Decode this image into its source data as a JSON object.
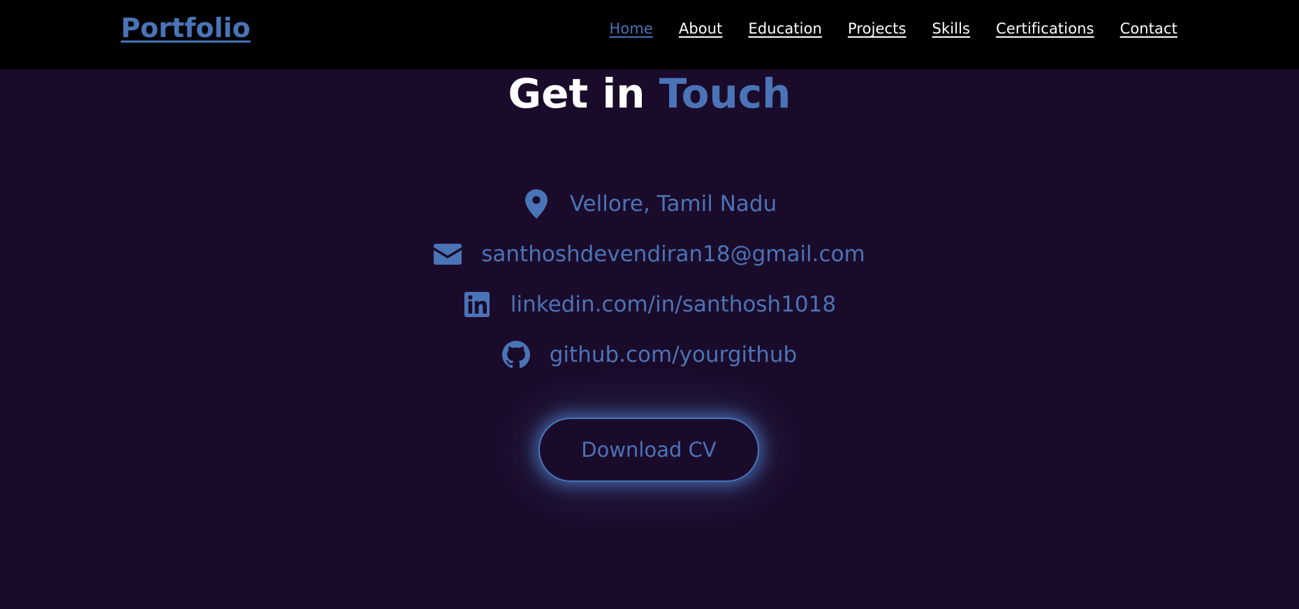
{
  "header": {
    "brand": "Portfolio",
    "nav": [
      {
        "label": "Home",
        "active": true
      },
      {
        "label": "About"
      },
      {
        "label": "Education"
      },
      {
        "label": "Projects"
      },
      {
        "label": "Skills"
      },
      {
        "label": "Certifications"
      },
      {
        "label": "Contact"
      }
    ]
  },
  "contact": {
    "title_main": "Get in ",
    "title_accent": "Touch",
    "items": [
      {
        "icon": "location-pin-icon",
        "text": "Vellore, Tamil Nadu"
      },
      {
        "icon": "envelope-icon",
        "text": "santhoshdevendiran18@gmail.com"
      },
      {
        "icon": "linkedin-icon",
        "text": "linkedin.com/in/santhosh1018"
      },
      {
        "icon": "github-icon",
        "text": "github.com/yourgithub"
      }
    ],
    "cv_button": "Download CV"
  },
  "colors": {
    "background": "#1b0b2a",
    "navbar": "#000000",
    "accent": "#4a74b8",
    "text": "#ffffff"
  }
}
